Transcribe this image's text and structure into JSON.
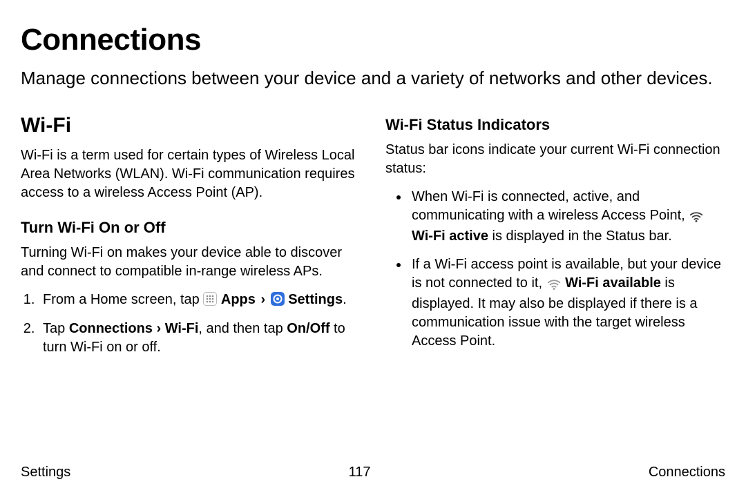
{
  "title": "Connections",
  "intro": "Manage connections between your device and a variety of networks and other devices.",
  "left": {
    "h2": "Wi-Fi",
    "p1": "Wi-Fi is a term used for certain types of Wireless Local Area Networks (WLAN). Wi-Fi communication requires access to a wireless Access Point (AP).",
    "h3": "Turn Wi-Fi On or Off",
    "p2": "Turning Wi-Fi on makes your device able to discover and connect to compatible in-range wireless APs.",
    "step1_a": "From a Home screen, tap ",
    "step1_apps": " Apps",
    "step1_sep": " › ",
    "step1_settings": " Settings",
    "step1_end": ".",
    "step2_a": "Tap ",
    "step2_b": "Connections › Wi-Fi",
    "step2_c": ", and then tap ",
    "step2_d": "On/Off",
    "step2_e": " to turn Wi-Fi on or off."
  },
  "right": {
    "h3": "Wi-Fi Status Indicators",
    "p1": "Status bar icons indicate your current Wi-Fi connection status:",
    "b1_a": "When Wi-Fi is connected, active, and communicating with a wireless Access Point, ",
    "b1_b": " Wi-Fi active",
    "b1_c": " is displayed in the Status bar.",
    "b2_a": "If a Wi-Fi access point is available, but your device is not connected to it, ",
    "b2_b": " Wi-Fi available",
    "b2_c": " is displayed. It may also be displayed if there is a communication issue with the target wireless Access Point."
  },
  "footer": {
    "left": "Settings",
    "center": "117",
    "right": "Connections"
  }
}
